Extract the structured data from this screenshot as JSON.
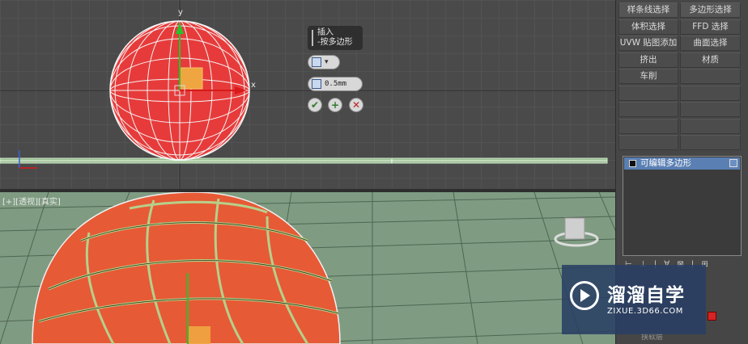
{
  "command_panel": {
    "rows": [
      [
        "样条线选择",
        "多边形选择"
      ],
      [
        "体积选择",
        "FFD 选择"
      ],
      [
        "UVW 贴图添加",
        "曲面选择"
      ],
      [
        "挤出",
        "材质"
      ],
      [
        "车削",
        ""
      ],
      [
        "",
        ""
      ],
      [
        "",
        ""
      ],
      [
        "",
        ""
      ],
      [
        "",
        ""
      ]
    ],
    "modifier_stack_item": "可编辑多边形",
    "stack_tools": "⊢ ⊥ | ∀ ⊠ | ⊞",
    "peek_text": "挟软层"
  },
  "caddy": {
    "title_line1": "插入",
    "title_line2": "-按多边形",
    "amount_value": "0.5mm",
    "type_arrow": "▾",
    "ok_icon": "✔",
    "apply_icon": "+",
    "cancel_icon": "✕"
  },
  "viewport_top": {
    "axis_y": "y",
    "axis_x": "x"
  },
  "viewport_bottom": {
    "label": "[+][透视][真实]"
  },
  "watermark": {
    "title": "溜溜自学",
    "url": "ZIXUE.3D66.COM"
  },
  "colors": {
    "sphere_red": "#e73b3b",
    "selection_blue": "#5a7fb3",
    "grid_green": "#7f9c82"
  }
}
